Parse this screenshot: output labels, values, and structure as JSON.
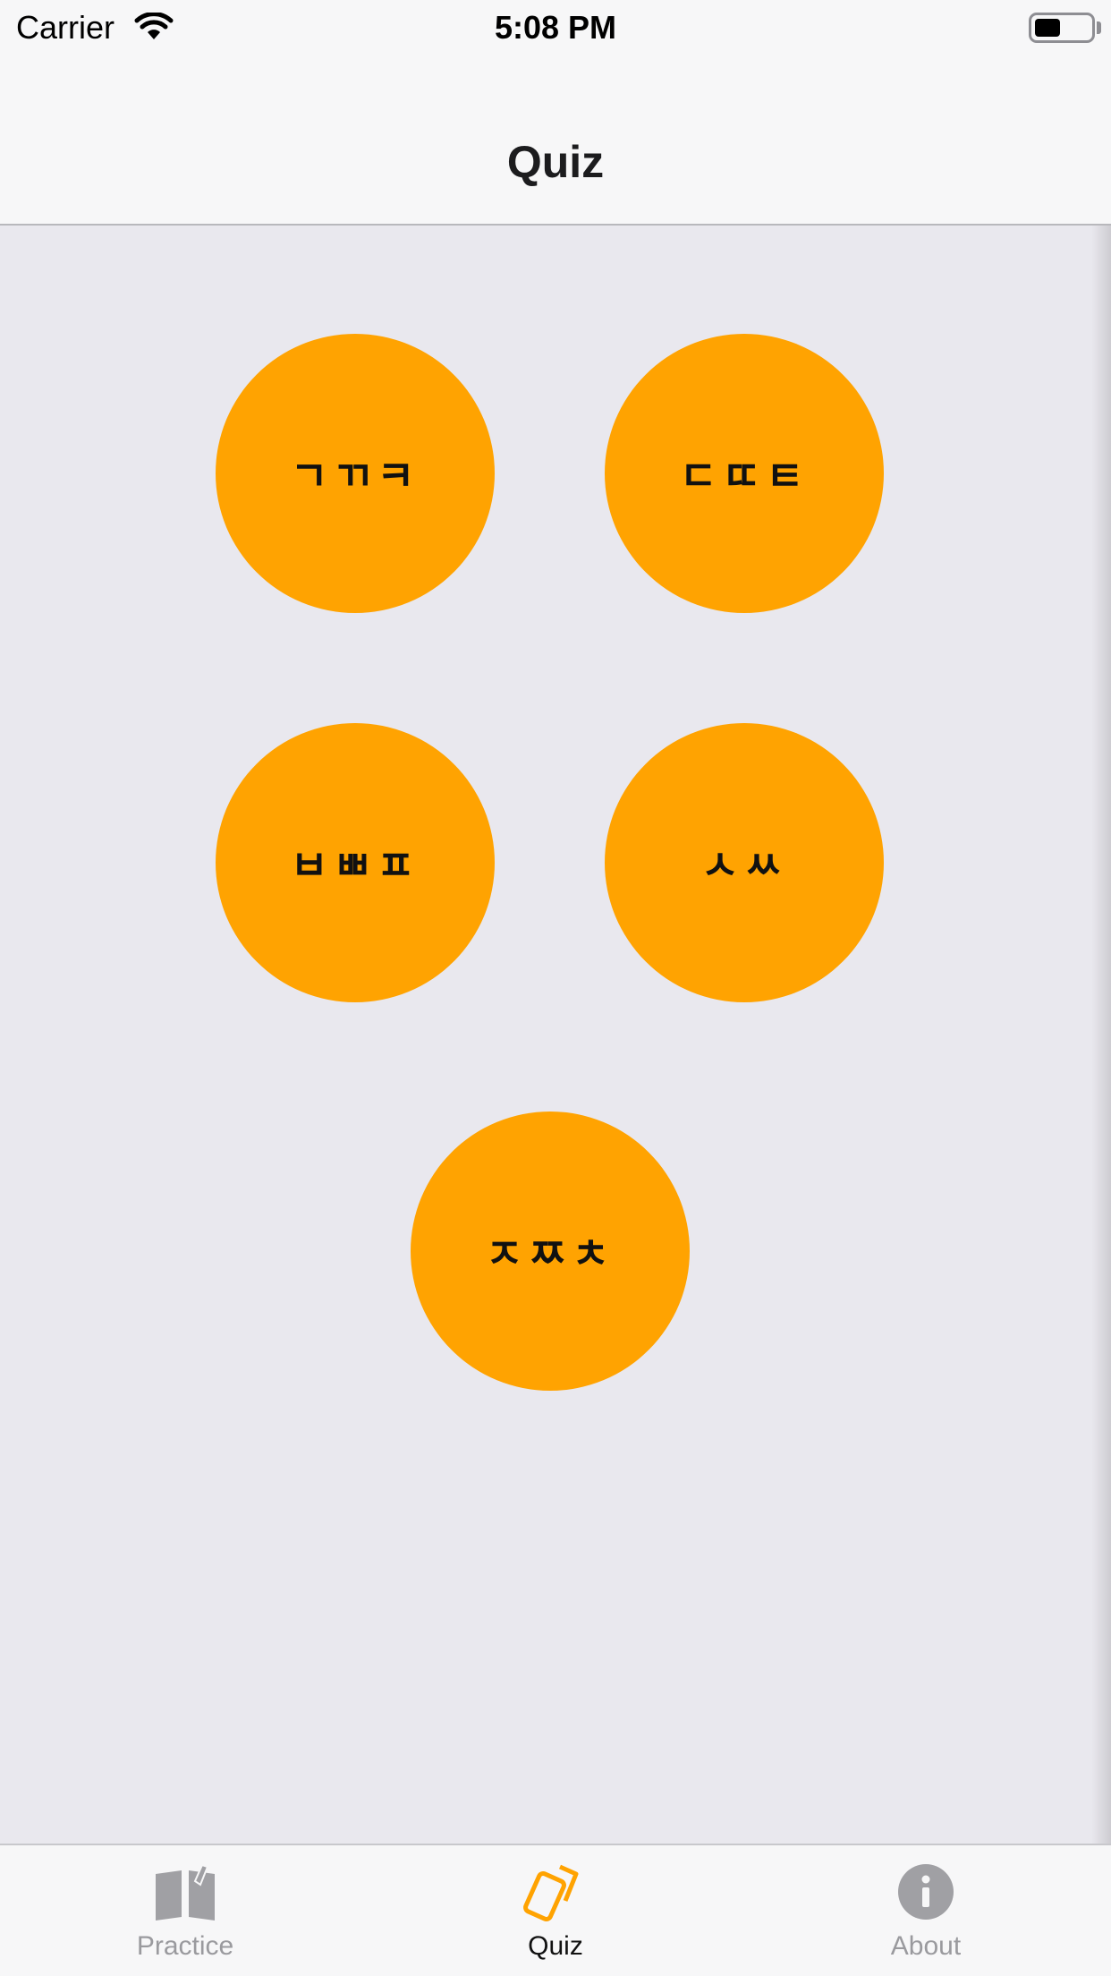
{
  "status_bar": {
    "carrier": "Carrier",
    "time": "5:08 PM"
  },
  "nav": {
    "title": "Quiz"
  },
  "quiz_groups": [
    {
      "label": "ㄱㄲㅋ"
    },
    {
      "label": "ㄷㄸㅌ"
    },
    {
      "label": "ㅂㅃㅍ"
    },
    {
      "label": "ㅅㅆ"
    },
    {
      "label": "ㅈㅉㅊ"
    }
  ],
  "tabs": [
    {
      "label": "Practice",
      "icon": "book-icon",
      "active": false
    },
    {
      "label": "Quiz",
      "icon": "cards-icon",
      "active": true
    },
    {
      "label": "About",
      "icon": "info-icon",
      "active": false
    }
  ],
  "colors": {
    "accent": "#ffa301",
    "inactive_tab": "#9a9a9e",
    "background": "#e9e8ee"
  }
}
